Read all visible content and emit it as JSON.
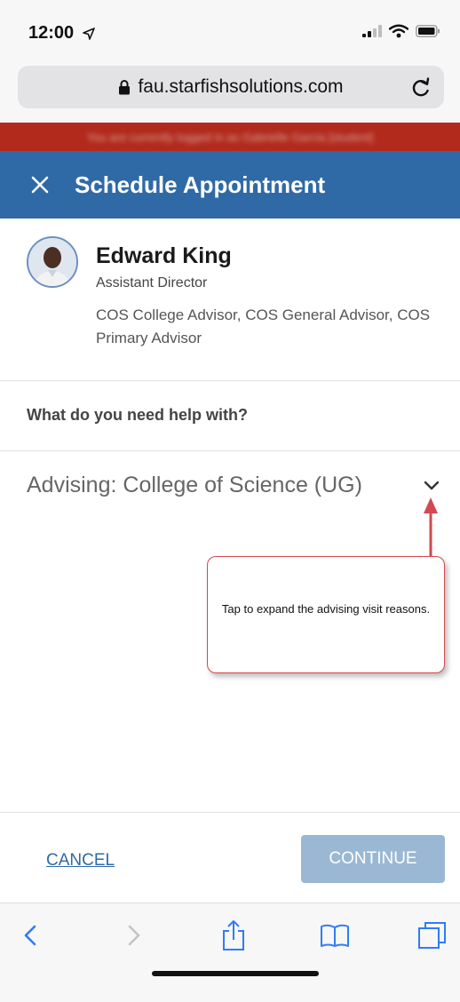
{
  "status_bar": {
    "time": "12:00"
  },
  "browser": {
    "url": "fau.starfishsolutions.com"
  },
  "banner": {
    "text": "You are currently logged in as Gabrielle Garcia [student]"
  },
  "header": {
    "title": "Schedule Appointment"
  },
  "advisor": {
    "name": "Edward King",
    "role": "Assistant Director",
    "groups": "COS College Advisor, COS General Advisor, COS Primary Advisor"
  },
  "form": {
    "question": "What do you need help with?",
    "selected_reason": "Advising: College of Science (UG)"
  },
  "annotation": {
    "text": "Tap to expand the advising visit reasons."
  },
  "actions": {
    "cancel_label": "CANCEL",
    "continue_label": "CONTINUE"
  },
  "colors": {
    "header_bg": "#2f6aa6",
    "banner_bg": "#b12a1c",
    "continue_disabled": "#9ab8d4",
    "annotation_red": "#d24a4f",
    "toolbar_icons": "#2f7cf6"
  },
  "icons": {
    "status": [
      "location-arrow-icon",
      "signal-icon",
      "wifi-icon",
      "battery-icon"
    ],
    "toolbar": [
      "back-icon",
      "forward-icon",
      "share-icon",
      "bookmarks-icon",
      "tabs-icon"
    ]
  }
}
